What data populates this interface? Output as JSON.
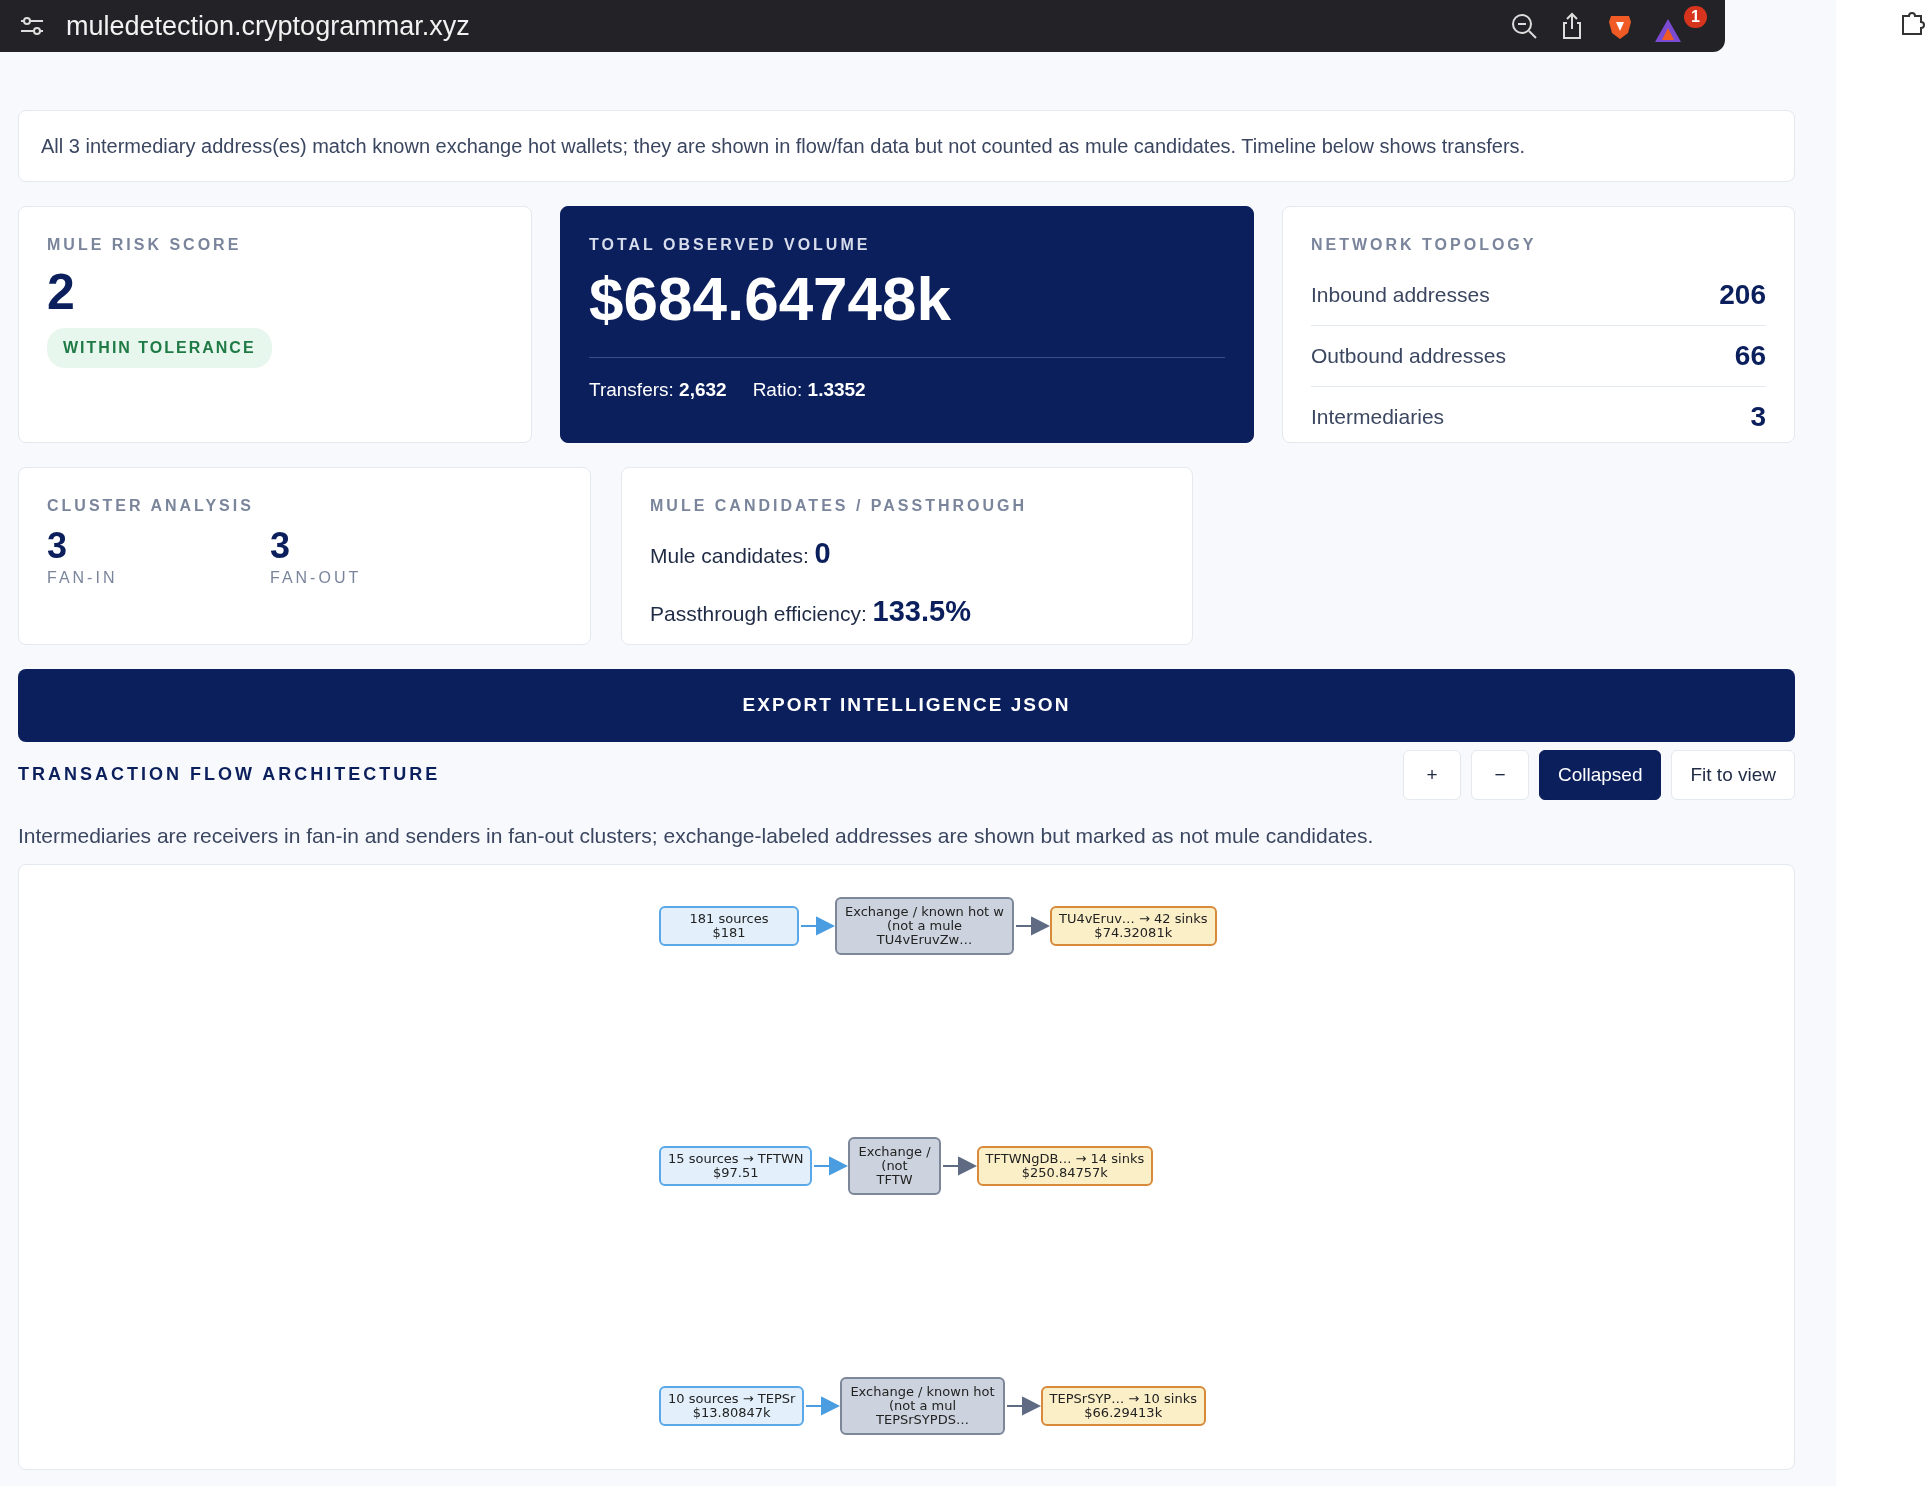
{
  "browser": {
    "url": "muledetection.cryptogrammar.xyz",
    "badge": "1"
  },
  "notice": "All 3 intermediary address(es) match known exchange hot wallets; they are shown in flow/fan data but not counted as mule candidates. Timeline below shows transfers.",
  "risk": {
    "label": "MULE RISK SCORE",
    "value": "2",
    "status": "WITHIN TOLERANCE"
  },
  "volume": {
    "label": "TOTAL OBSERVED VOLUME",
    "value": "$684.64748k",
    "transfers_label": "Transfers:",
    "transfers": "2,632",
    "ratio_label": "Ratio:",
    "ratio": "1.3352"
  },
  "topology": {
    "label": "NETWORK TOPOLOGY",
    "rows": [
      {
        "name": "Inbound addresses",
        "value": "206"
      },
      {
        "name": "Outbound addresses",
        "value": "66"
      },
      {
        "name": "Intermediaries",
        "value": "3"
      }
    ]
  },
  "cluster": {
    "label": "CLUSTER ANALYSIS",
    "stats": [
      {
        "value": "3",
        "label": "FAN-IN"
      },
      {
        "value": "3",
        "label": "FAN-OUT"
      }
    ]
  },
  "mule": {
    "label": "MULE CANDIDATES / PASSTHROUGH",
    "rows": [
      {
        "name": "Mule candidates:",
        "value": "0"
      },
      {
        "name": "Passthrough efficiency:",
        "value": "133.5%"
      }
    ]
  },
  "export_button": "EXPORT INTELLIGENCE JSON",
  "flow": {
    "title": "TRANSACTION FLOW ARCHITECTURE",
    "controls": [
      {
        "label": "+",
        "selected": false
      },
      {
        "label": "−",
        "selected": false
      },
      {
        "label": "Collapsed",
        "selected": true
      },
      {
        "label": "Fit to view",
        "selected": false
      }
    ],
    "description": "Intermediaries are receivers in fan-in and senders in fan-out clusters; exchange-labeled addresses are shown but marked as not mule candidates.",
    "clusters": [
      {
        "source": [
          "181 sources",
          "$181"
        ],
        "intermediary": [
          "Exchange / known hot w",
          "(not a mule",
          "TU4vEruvZw…"
        ],
        "sink": [
          "TU4vEruv… → 42 sinks",
          "$74.32081k"
        ]
      },
      {
        "source": [
          "15 sources → TFTWN",
          "$97.51"
        ],
        "intermediary": [
          "Exchange /",
          "(not",
          "TFTW"
        ],
        "sink": [
          "TFTWNgDB… → 14 sinks",
          "$250.84757k"
        ]
      },
      {
        "source": [
          "10 sources → TEPSr",
          "$13.80847k"
        ],
        "intermediary": [
          "Exchange / known hot",
          "(not a mul",
          "TEPSrSYPDS…"
        ],
        "sink": [
          "TEPSrSYP… → 10 sinks",
          "$66.29413k"
        ]
      }
    ]
  }
}
